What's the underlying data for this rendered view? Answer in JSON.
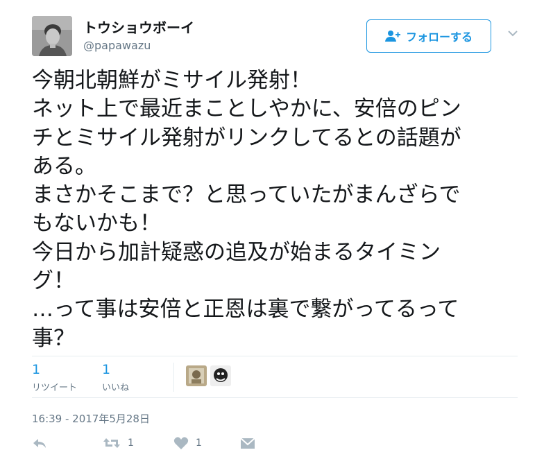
{
  "tweet": {
    "author": {
      "display_name": "トウショウボーイ",
      "handle": "@papawazu"
    },
    "follow_label": "フォローする",
    "text_lines": [
      "今朝北朝鮮がミサイル発射！",
      "ネット上で最近まことしやかに、安倍のピン",
      "チとミサイル発射がリンクしてるとの話題が",
      "ある。",
      "まさかそこまで？と思っていたがまんざらで",
      "もないかも！",
      "今日から加計疑惑の追及が始まるタイミン",
      "グ！",
      "…って事は安倍と正恩は裏で繋がってるって",
      "事？"
    ],
    "stats": {
      "retweets": {
        "count": "1",
        "label": "リツイート"
      },
      "likes": {
        "count": "1",
        "label": "いいね"
      }
    },
    "timestamp": "16:39 - 2017年5月28日",
    "actions": {
      "retweet_count": "1",
      "like_count": "1"
    }
  },
  "colors": {
    "accent": "#1b95e0",
    "secondary_text": "#657786",
    "icon": "#aab8c2",
    "divider": "#e6ecf0"
  }
}
